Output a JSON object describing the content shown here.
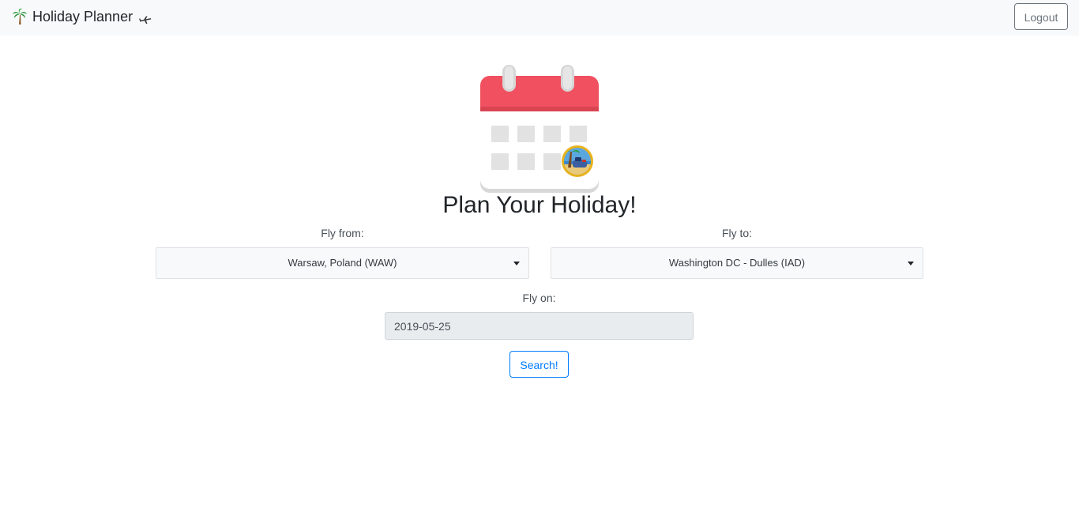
{
  "navbar": {
    "brand_label": "Holiday Planner",
    "brand_icons": [
      "palm-tree-icon",
      "airplane-icon"
    ],
    "logout_label": "Logout"
  },
  "main": {
    "illustration": "calendar-icon",
    "title": "Plan Your Holiday!",
    "fly_from": {
      "label": "Fly from:",
      "value": "Warsaw, Poland (WAW)"
    },
    "fly_to": {
      "label": "Fly to:",
      "value": "Washington DC - Dulles (IAD)"
    },
    "fly_on": {
      "label": "Fly on:",
      "value": "2019-05-25"
    },
    "search_label": "Search!"
  },
  "colors": {
    "navbar_bg": "#f8f9fa",
    "calendar_header": "#f0505f",
    "primary": "#007bff",
    "secondary": "#6c757d"
  }
}
